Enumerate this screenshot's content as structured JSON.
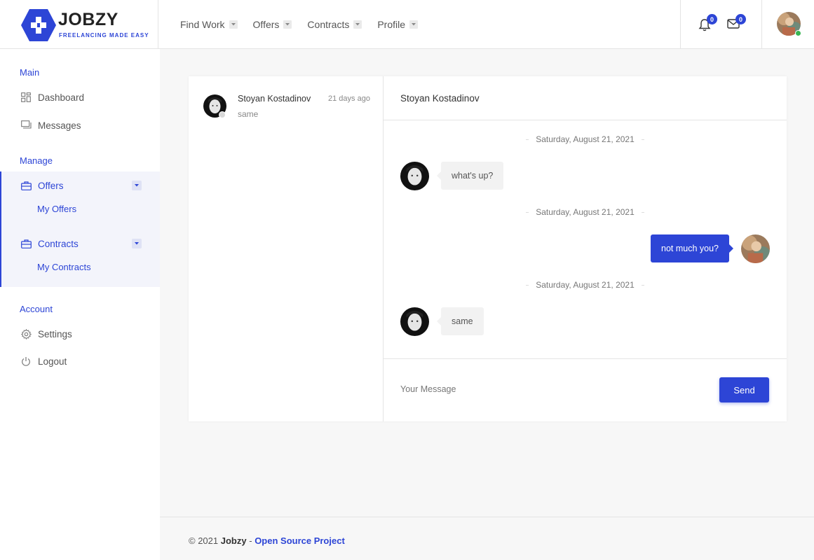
{
  "brand": {
    "name": "JOBZY",
    "tagline": "FREELANCING MADE EASY",
    "accent_color": "#2d45d6"
  },
  "topnav": {
    "items": [
      {
        "label": "Find Work"
      },
      {
        "label": "Offers"
      },
      {
        "label": "Contracts"
      },
      {
        "label": "Profile"
      }
    ]
  },
  "header": {
    "notifications_count": "0",
    "messages_count": "0",
    "notifications_icon": "bell-icon",
    "messages_icon": "mail-icon"
  },
  "sidebar": {
    "main_heading": "Main",
    "dashboard": "Dashboard",
    "messages": "Messages",
    "manage_heading": "Manage",
    "offers": "Offers",
    "my_offers": "My Offers",
    "contracts": "Contracts",
    "my_contracts": "My Contracts",
    "account_heading": "Account",
    "settings": "Settings",
    "logout": "Logout"
  },
  "conversations": [
    {
      "name": "Stoyan Kostadinov",
      "time": "21 days ago",
      "preview": "same"
    }
  ],
  "chat": {
    "title": "Stoyan Kostadinov",
    "messages": [
      {
        "date": "Saturday, August 21, 2021",
        "text": "what's up?",
        "direction": "incoming"
      },
      {
        "date": "Saturday, August 21, 2021",
        "text": "not much you?",
        "direction": "outgoing"
      },
      {
        "date": "Saturday, August 21, 2021",
        "text": "same",
        "direction": "incoming"
      }
    ],
    "input_placeholder": "Your Message",
    "send_label": "Send"
  },
  "footer": {
    "copyright": "© 2021",
    "brand": "Jobzy",
    "separator": "-",
    "link": "Open Source Project"
  }
}
